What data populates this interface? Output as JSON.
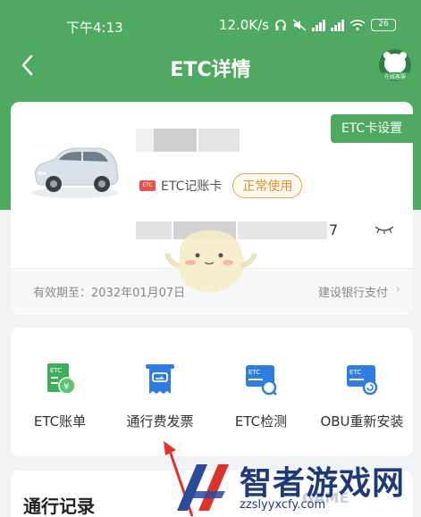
{
  "status_bar": {
    "time": "下午4:13",
    "speed": "12.0K/s",
    "battery": "26"
  },
  "nav": {
    "title": "ETC详情",
    "service_label": "在线客服"
  },
  "etc_card": {
    "settings_button": "ETC卡设置",
    "card_type": "ETC记账卡",
    "card_type_icon": "ETC",
    "status": "正常使用",
    "card_number_tail": "7",
    "valid_until": "有效期至：2032年01月07日",
    "bank": "建设银行支付",
    "bank_chevron": "›"
  },
  "actions": [
    {
      "label": "ETC账单",
      "icon": "etc-bill-icon"
    },
    {
      "label": "通行费发票",
      "icon": "invoice-icon"
    },
    {
      "label": "ETC检测",
      "icon": "etc-check-icon"
    },
    {
      "label": "OBU重新安装",
      "icon": "obu-reinstall-icon"
    }
  ],
  "records": {
    "title": "通行记录"
  },
  "watermark": {
    "text": "智者游戏网",
    "url": "zzslyyxcfy.com",
    "overlay": "GAME"
  },
  "colors": {
    "brand_green": "#4fa961",
    "icon_blue": "#2f7de1",
    "icon_green": "#3fae5a",
    "badge_orange": "#e0912b"
  }
}
